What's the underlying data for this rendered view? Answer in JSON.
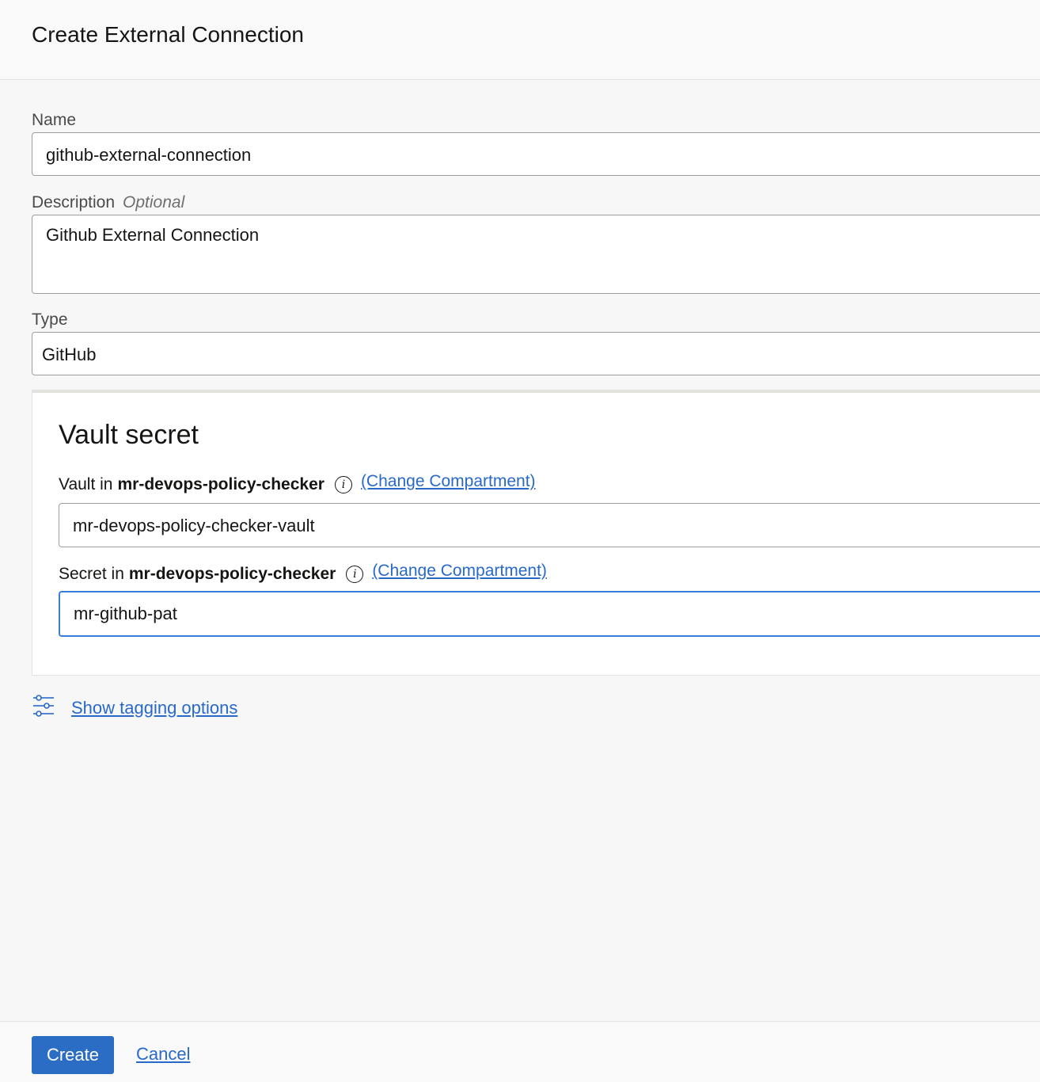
{
  "header": {
    "title": "Create External Connection"
  },
  "form": {
    "name": {
      "label": "Name",
      "value": "github-external-connection"
    },
    "description": {
      "label": "Description",
      "optional": "Optional",
      "value": "Github External Connection"
    },
    "type": {
      "label": "Type",
      "value": "GitHub"
    }
  },
  "vault_secret": {
    "title": "Vault secret",
    "vault": {
      "label_prefix": "Vault in",
      "compartment": "mr-devops-policy-checker",
      "change_link": "(Change Compartment)",
      "value": "mr-devops-policy-checker-vault"
    },
    "secret": {
      "label_prefix": "Secret in",
      "compartment": "mr-devops-policy-checker",
      "change_link": "(Change Compartment)",
      "value": "mr-github-pat"
    }
  },
  "tagging": {
    "link": "Show tagging options",
    "icon": "sliders-icon"
  },
  "footer": {
    "create": "Create",
    "cancel": "Cancel"
  },
  "colors": {
    "accent": "#2869c9",
    "button": "#2b6cc4",
    "focus": "#3b7ddd"
  }
}
